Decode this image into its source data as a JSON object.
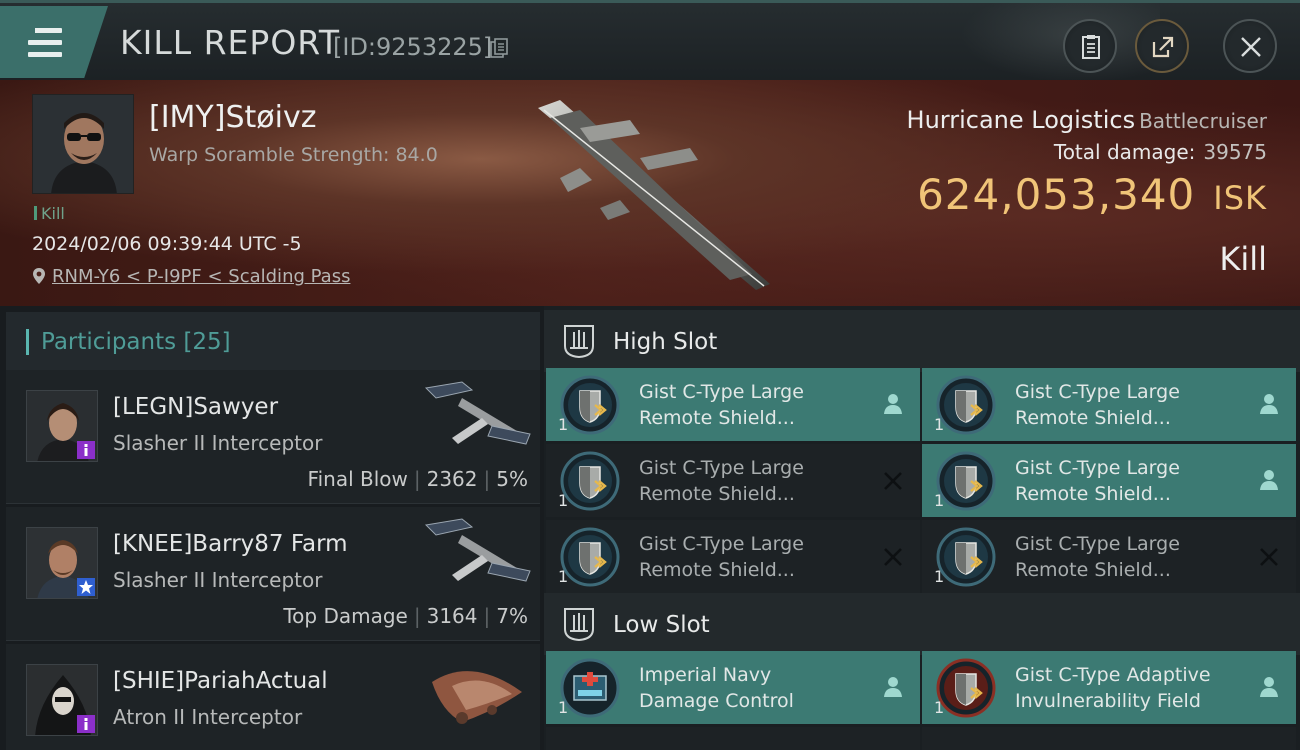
{
  "header": {
    "title": "KILL REPORT",
    "id_label": "[ID:9253225]"
  },
  "victim": {
    "name": "[IMY]Støivz",
    "sub": "Warp Soramble Strength: 84.0",
    "tag": "Kill",
    "datetime": "2024/02/06 09:39:44 UTC -5",
    "location": "RNM-Y6 < P-I9PF < Scalding Pass"
  },
  "ship": {
    "name": "Hurricane Logistics",
    "class": "Battlecruiser",
    "total_damage_label": "Total damage:",
    "total_damage": "39575",
    "isk_value": "624,053,340",
    "isk_unit": "ISK",
    "result": "Kill"
  },
  "participants": {
    "label": "Participants",
    "count": "[25]",
    "rows": [
      {
        "name": "[LEGN]Sawyer",
        "ship": "Slasher II Interceptor",
        "role": "Final Blow",
        "damage": "2362",
        "percent": "5%",
        "badge": "purple"
      },
      {
        "name": "[KNEE]Barry87 Farm",
        "ship": "Slasher II Interceptor",
        "role": "Top Damage",
        "damage": "3164",
        "percent": "7%",
        "badge": "blue-star"
      },
      {
        "name": "[SHIE]PariahActual",
        "ship": "Atron II Interceptor",
        "role": "",
        "damage": "",
        "percent": "",
        "badge": "purple"
      }
    ]
  },
  "fitting": {
    "high_slot_label": "High Slot",
    "low_slot_label": "Low Slot",
    "high": [
      {
        "line1": "Gist C-Type Large",
        "line2": "Remote Shield...",
        "qty": "1",
        "state": "active"
      },
      {
        "line1": "Gist C-Type Large",
        "line2": "Remote Shield...",
        "qty": "1",
        "state": "active"
      },
      {
        "line1": "Gist C-Type Large",
        "line2": "Remote Shield...",
        "qty": "1",
        "state": "destroyed"
      },
      {
        "line1": "Gist C-Type Large",
        "line2": "Remote Shield...",
        "qty": "1",
        "state": "active"
      },
      {
        "line1": "Gist C-Type Large",
        "line2": "Remote Shield...",
        "qty": "1",
        "state": "destroyed"
      },
      {
        "line1": "Gist C-Type Large",
        "line2": "Remote Shield...",
        "qty": "1",
        "state": "destroyed"
      }
    ],
    "low": [
      {
        "line1": "Imperial Navy",
        "line2": "Damage Control",
        "qty": "1",
        "state": "active"
      },
      {
        "line1": "Gist C-Type Adaptive",
        "line2": "Invulnerability Field",
        "qty": "1",
        "state": "active"
      }
    ]
  },
  "colors": {
    "accent": "#3c7a73",
    "isk": "#f0c478",
    "participants_label": "#4f9c97"
  }
}
